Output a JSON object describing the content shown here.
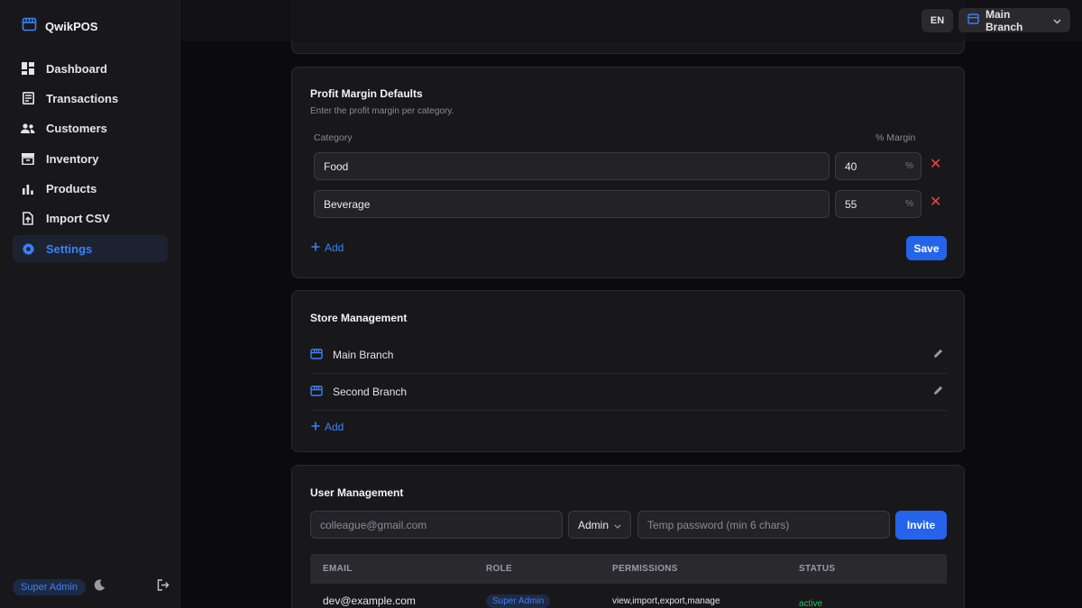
{
  "app": {
    "name": "QwikPOS"
  },
  "sidebar": {
    "items": [
      {
        "label": "Dashboard"
      },
      {
        "label": "Transactions"
      },
      {
        "label": "Customers"
      },
      {
        "label": "Inventory"
      },
      {
        "label": "Products"
      },
      {
        "label": "Import CSV"
      },
      {
        "label": "Settings",
        "active": true
      }
    ],
    "role_badge": "Super Admin"
  },
  "header": {
    "language": "EN",
    "branch": "Main Branch"
  },
  "profit_margin": {
    "title": "Profit Margin Defaults",
    "subtitle": "Enter the profit margin per category.",
    "col_category": "Category",
    "col_margin": "% Margin",
    "unit": "%",
    "rows": [
      {
        "category": "Food",
        "margin": "40"
      },
      {
        "category": "Beverage",
        "margin": "55"
      }
    ],
    "add_label": "Add",
    "save_label": "Save"
  },
  "store_management": {
    "title": "Store Management",
    "stores": [
      {
        "name": "Main Branch"
      },
      {
        "name": "Second Branch"
      }
    ],
    "add_label": "Add"
  },
  "user_management": {
    "title": "User Management",
    "email_placeholder": "colleague@gmail.com",
    "role_value": "Admin",
    "password_placeholder": "Temp password (min 6 chars)",
    "invite_label": "Invite",
    "columns": [
      "EMAIL",
      "ROLE",
      "PERMISSIONS",
      "STATUS"
    ],
    "rows": [
      {
        "email": "dev@example.com",
        "role": "Super Admin",
        "permissions": "view,import,export,manage",
        "status": "active"
      }
    ]
  },
  "colors": {
    "accent": "#3b82f6",
    "primary_button": "#2563eb",
    "danger": "#ef4444",
    "success": "#22c55e"
  }
}
